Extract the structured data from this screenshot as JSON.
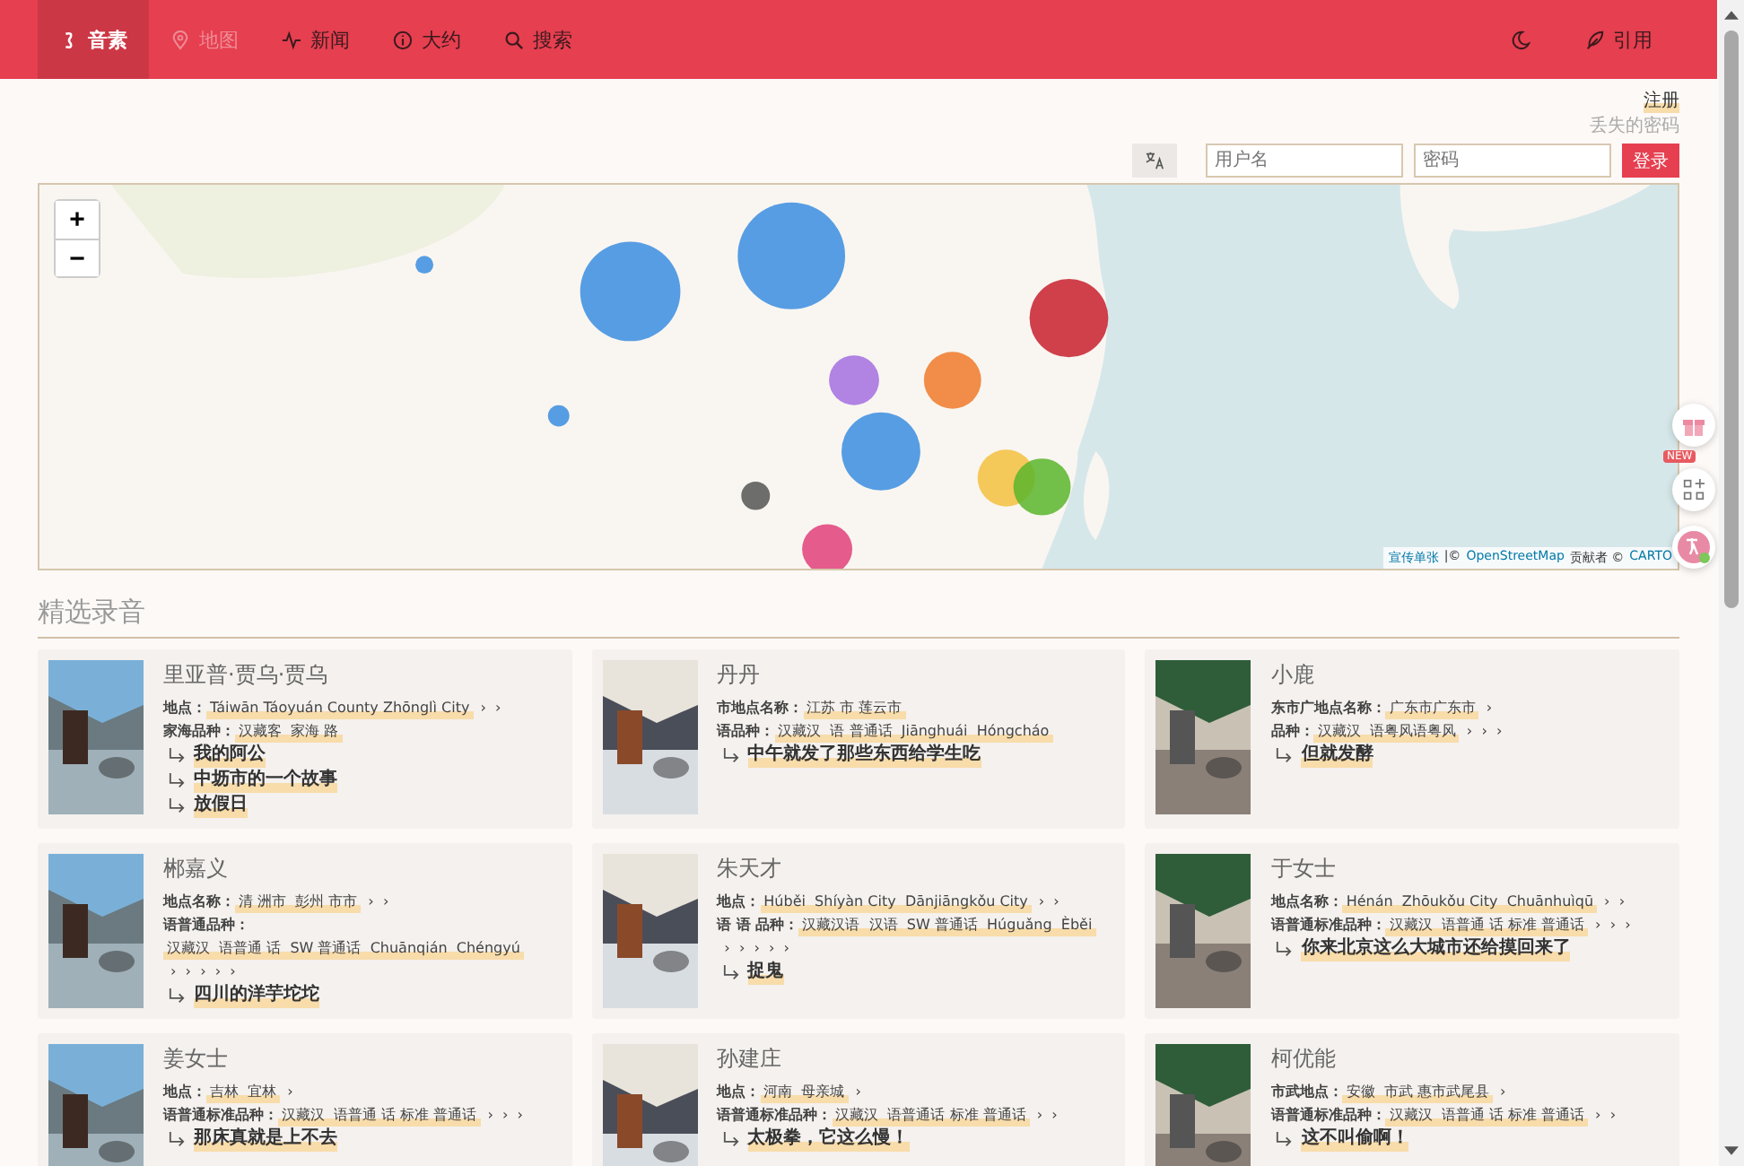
{
  "nav": {
    "items": [
      {
        "label": "音素",
        "kind": "phoneme",
        "selected": true,
        "disabled": false
      },
      {
        "label": "地图",
        "kind": "map",
        "selected": false,
        "disabled": true
      },
      {
        "label": "新闻",
        "kind": "news",
        "selected": false,
        "disabled": false
      },
      {
        "label": "大约",
        "kind": "about",
        "selected": false,
        "disabled": false
      },
      {
        "label": "搜索",
        "kind": "search",
        "selected": false,
        "disabled": false
      }
    ],
    "cite": "引用"
  },
  "account": {
    "register": "注册",
    "lost_password": "丢失的密码",
    "username": {
      "placeholder": "用户名"
    },
    "password": {
      "placeholder": "密码"
    },
    "login": "登录"
  },
  "map": {
    "zoom_in": "+",
    "zoom_out": "−",
    "attribution": [
      {
        "text": "宣传单张",
        "kind": "link"
      },
      {
        "text": "|©",
        "kind": "text"
      },
      {
        "text": "OpenStreetMap",
        "kind": "link"
      },
      {
        "text": "贡献者 ©",
        "kind": "text"
      },
      {
        "text": "CARTO",
        "kind": "link"
      }
    ]
  },
  "floating": {
    "badge": "NEW"
  },
  "section_title": "精选录音",
  "cards": [
    {
      "name": "里亚普·贾乌·贾乌",
      "lines": [
        {
          "label": "地点：",
          "value": "Táiwān Táoyuán County Zhōnglì City",
          "more": "›  ›"
        },
        {
          "label": "家海品种：",
          "value": "汉藏客  家海 路"
        }
      ],
      "stories": [
        "我的阿公",
        "中坜市的一个故事",
        "放假日"
      ]
    },
    {
      "name": "丹丹",
      "lines": [
        {
          "label": "市地点名称：",
          "value": "江苏 市 莲云市"
        },
        {
          "label": "语品种：",
          "value": "汉藏汉  语 普通话  Jiānghuái  Hóngcháo"
        }
      ],
      "stories": [
        "中午就发了那些东西给学生吃"
      ]
    },
    {
      "name": "小鹿",
      "lines": [
        {
          "label": "东市广地点名称：",
          "value": "广东市广东市",
          "more": "›"
        },
        {
          "label": "品种：",
          "value": "汉藏汉  语粤风语粤风",
          "more": "›  ›  ›"
        }
      ],
      "stories": [
        "但就发酵"
      ]
    },
    {
      "name": "郴嘉义",
      "lines": [
        {
          "label": "地点名称：",
          "value": "清 洲市  彭州 市市",
          "more": "›  ›"
        },
        {
          "label": "语普通品种：",
          "value": "汉藏汉  语普通 话  SW 普通话  Chuānqián  Chéngyú",
          "more": "›  ›  ›  ›  ›"
        }
      ],
      "stories": [
        "四川的洋芋坨坨"
      ]
    },
    {
      "name": "朱天才",
      "lines": [
        {
          "label": "地点：",
          "value": "Húběi  Shíyàn City  Dānjiāngkǒu City",
          "more": "›  ›"
        },
        {
          "label": "语 语 品种：",
          "value": "汉藏汉语  汉语  SW 普通话  Húguǎng  Èběi",
          "more": "›  ›  ›  ›  ›"
        }
      ],
      "stories": [
        "捉鬼"
      ]
    },
    {
      "name": "于女士",
      "lines": [
        {
          "label": "地点名称：",
          "value": "Hénán  Zhōukǒu City  Chuānhuìqū",
          "more": "›  ›"
        },
        {
          "label": "语普通标准品种：",
          "value": "汉藏汉  语普通 话 标准 普通话",
          "more": "›  ›  ›"
        }
      ],
      "stories": [
        "你来北京这么大城市还给摸回来了"
      ]
    },
    {
      "name": "姜女士",
      "lines": [
        {
          "label": "地点：",
          "value": "吉林  宜林",
          "more": "›"
        },
        {
          "label": "语普通标准品种：",
          "value": "汉藏汉  语普通 话 标准 普通话",
          "more": "›  ›  ›"
        }
      ],
      "stories": [
        "那床真就是上不去"
      ]
    },
    {
      "name": "孙建庄",
      "lines": [
        {
          "label": "地点：",
          "value": "河南  母亲城",
          "more": "›"
        },
        {
          "label": "语普通标准品种：",
          "value": "汉藏汉  语普通话 标准 普通话",
          "more": "›  ›"
        }
      ],
      "stories": [
        "太极拳，它这么慢！"
      ]
    },
    {
      "name": "柯优能",
      "lines": [
        {
          "label": "市武地点：",
          "value": "安徽  市武 惠市武尾县",
          "more": "›"
        },
        {
          "label": "语普通标准品种：",
          "value": "汉藏汉  语普通 话 标准 普通话",
          "more": "›  ›"
        }
      ],
      "stories": [
        "这不叫偷啊！"
      ]
    }
  ]
}
